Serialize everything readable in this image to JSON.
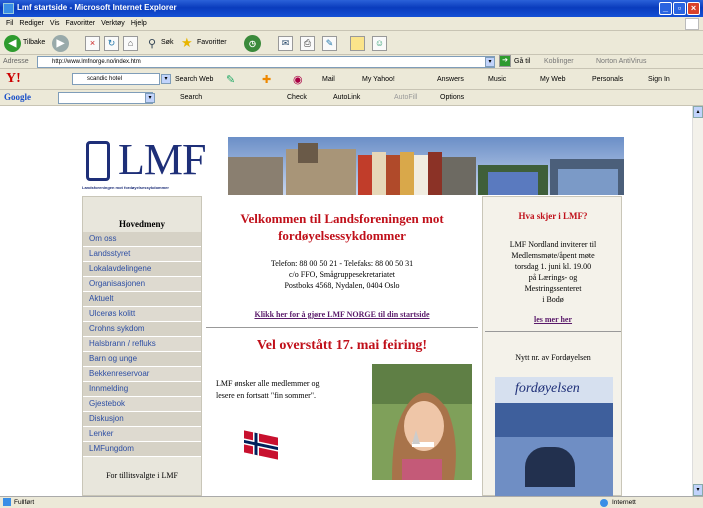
{
  "window": {
    "title": "Lmf startside - Microsoft Internet Explorer"
  },
  "menu": [
    "Fil",
    "Rediger",
    "Vis",
    "Favoritter",
    "Verktøy",
    "Hjelp"
  ],
  "toolbar": {
    "back": "Tilbake",
    "search": "Søk",
    "favorites": "Favoritter"
  },
  "address": {
    "label": "Adresse",
    "url": "http://www.lmfnorge.no/index.htm",
    "go": "Gå til",
    "links": "Koblinger",
    "norton": "Norton AntiVirus"
  },
  "yahoo": {
    "search_value": "scandic hotel",
    "search_web": "Search Web",
    "mail": "Mail",
    "my_yahoo": "My Yahoo!",
    "answers": "Answers",
    "music": "Music",
    "my_web": "My Web",
    "personals": "Personals",
    "sign_in": "Sign In"
  },
  "google": {
    "logo": "Google",
    "search": "Search",
    "check": "Check",
    "autolink": "AutoLink",
    "autofill": "AutoFill",
    "options": "Options"
  },
  "site": {
    "logo": "LMF",
    "logo_sub": "Landsforeningen mot fordøyelsessykdommer",
    "menu_heading": "Hovedmeny",
    "menu_items": [
      "Om oss",
      "Landsstyret",
      "Lokalavdelingene",
      "Organisasjonen",
      "Aktuelt",
      "Ulcerøs kolitt",
      "Crohns sykdom",
      "Halsbrann / refluks",
      "Barn og unge",
      "Bekkenreservoar",
      "Innmelding",
      "Gjestebok",
      "Diskusjon",
      "Lenker",
      "LMFungdom"
    ],
    "menu_footer": "For tillitsvalgte i LMF",
    "welcome_l1": "Velkommen til Landsforeningen mot",
    "welcome_l2": "fordøyelsessykdommer",
    "contact_l1": "Telefon: 88 00 50 21 - Telefaks: 88 00 50 31",
    "contact_l2": "c/o FFO, Smågruppesekretariatet",
    "contact_l3": "Postboks 4568, Nydalen, 0404 Oslo",
    "startpage_link": "Klikk her for å gjøre LMF NORGE til din startside",
    "feiring": "Vel overstått 17. mai feiring!",
    "summer_l1": "LMF ønsker alle medlemmer og",
    "summer_l2": "lesere en fortsatt \"fin sommer\".",
    "hva_skjer": "Hva skjer i LMF?",
    "event_l1": "LMF Nordland inviterer til",
    "event_l2": "Medlemsmøte/åpent møte",
    "event_l3": "torsdag 1. juni kl. 19.00",
    "event_l4": "på Lærings- og",
    "event_l5": "Mestringssenteret",
    "event_l6": "i Bodø",
    "les_mer": "les mer her",
    "nytt": "Nytt nr. av Fordøyelsen",
    "magazine_title": "fordøyelsen"
  },
  "status": {
    "left": "Fullført",
    "right": "Internett"
  }
}
